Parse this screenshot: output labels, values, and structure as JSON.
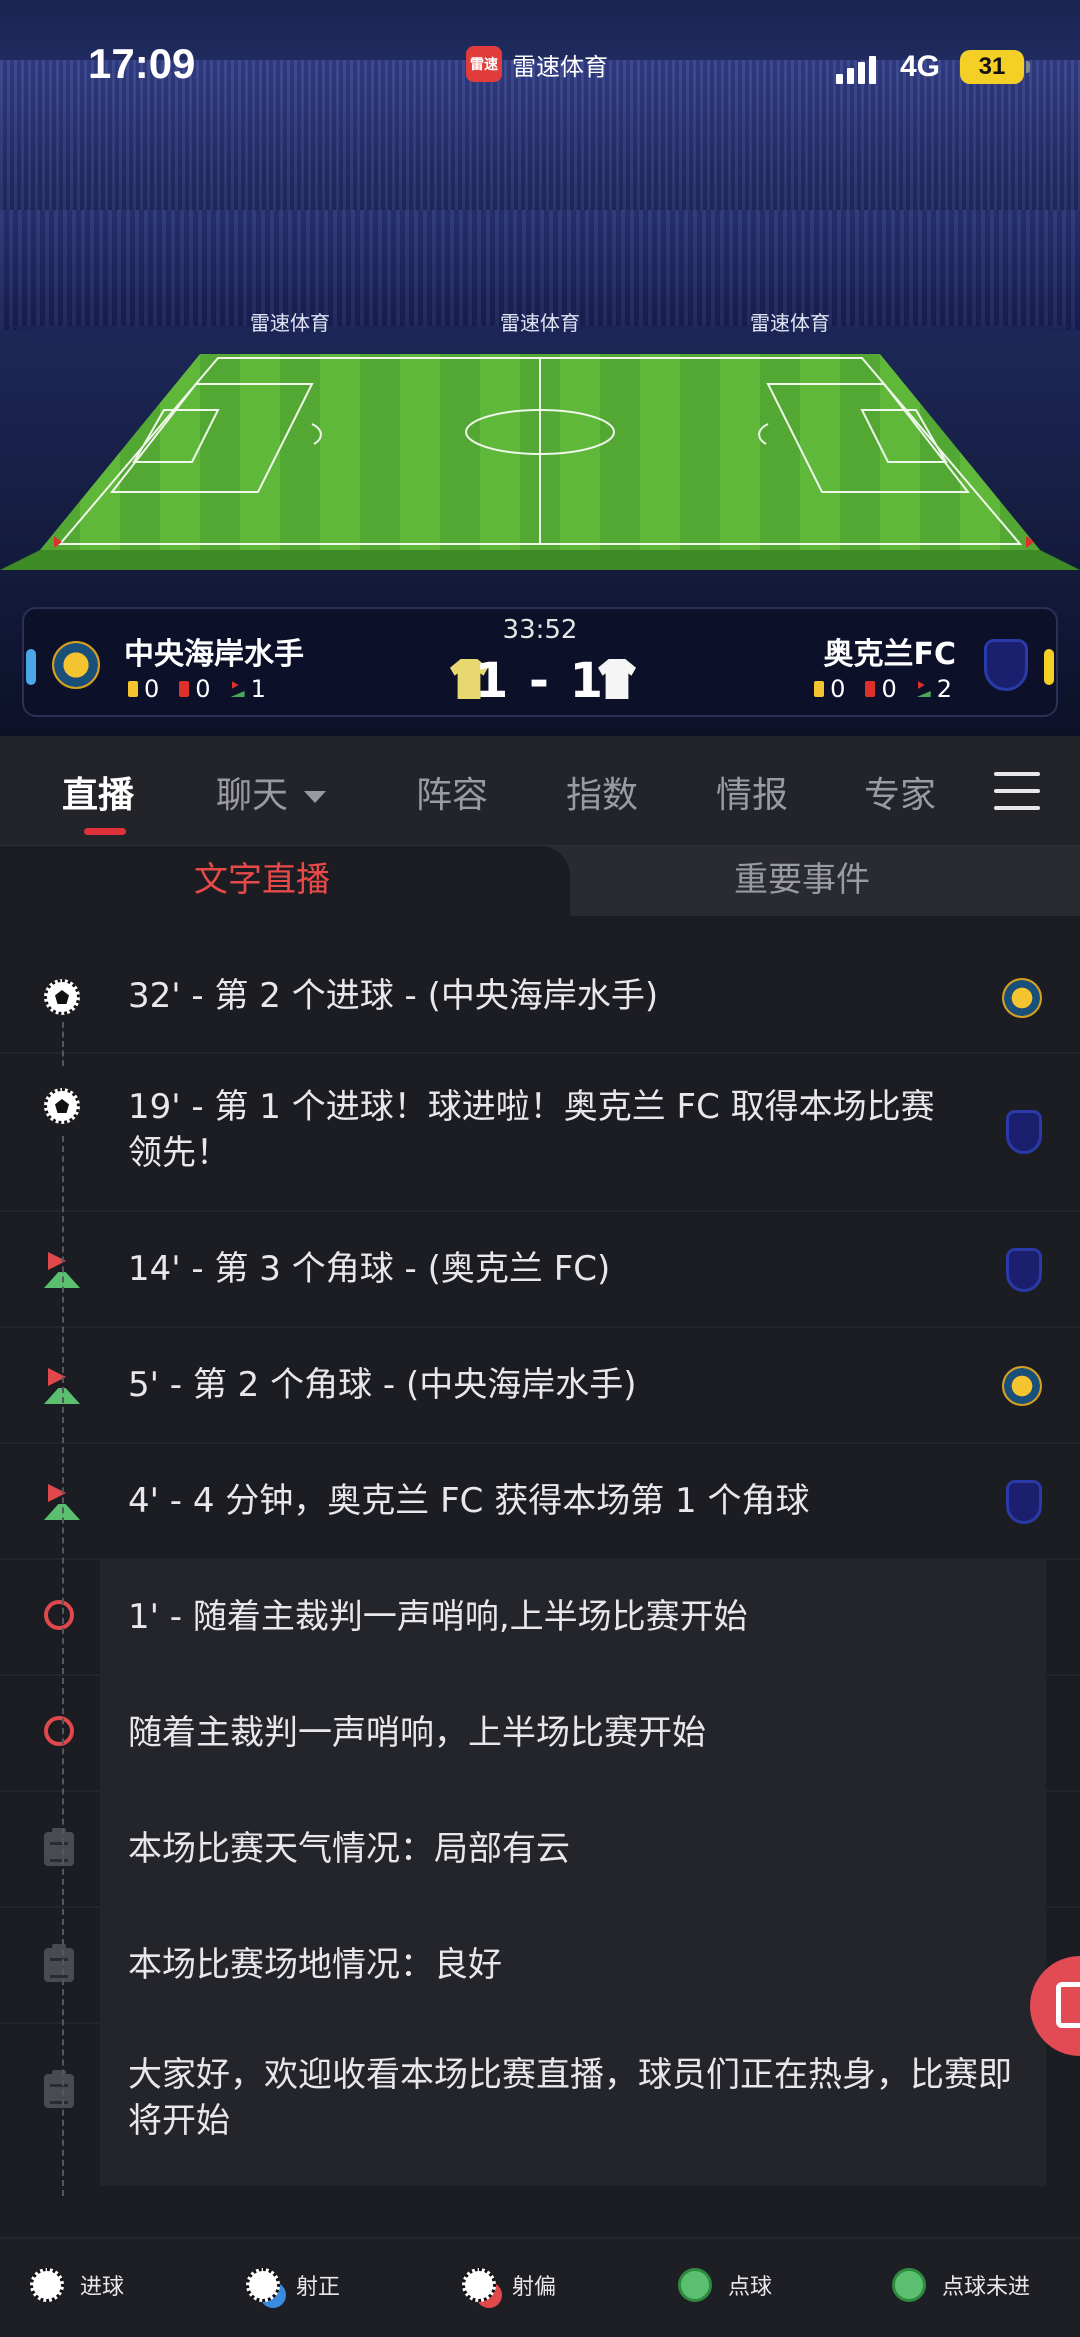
{
  "status_bar": {
    "time": "17:09",
    "app_name": "雷速体育",
    "app_badge": "雷速",
    "network": "4G",
    "battery": "31"
  },
  "match": {
    "clock": "33:52",
    "score": "1 - 1",
    "home": {
      "name": "中央海岸水手",
      "yellow": "0",
      "red": "0",
      "corners": "1"
    },
    "away": {
      "name": "奥克兰FC",
      "yellow": "0",
      "red": "0",
      "corners": "2"
    }
  },
  "pitch_ads": [
    "雷速体育",
    "雷速体育",
    "雷速体育"
  ],
  "tabs": [
    {
      "label": "直播",
      "active": true
    },
    {
      "label": "聊天",
      "active": false
    },
    {
      "label": "阵容",
      "active": false
    },
    {
      "label": "指数",
      "active": false
    },
    {
      "label": "情报",
      "active": false
    },
    {
      "label": "专家",
      "active": false
    }
  ],
  "subtabs": {
    "text_live": "文字直播",
    "key_events": "重要事件"
  },
  "events": [
    {
      "type": "goal",
      "team": "home",
      "text": "32' - 第 2 个进球 - (中央海岸水手)"
    },
    {
      "type": "goal",
      "team": "away",
      "text": "19' - 第 1 个进球！球进啦！奥克兰 FC 取得本场比赛领先！"
    },
    {
      "type": "corner",
      "team": "away",
      "text": "14' - 第 3 个角球 - (奥克兰 FC)"
    },
    {
      "type": "corner",
      "team": "home",
      "text": "5' - 第 2 个角球 - (中央海岸水手)"
    },
    {
      "type": "corner",
      "team": "away",
      "text": "4' - 4 分钟，奥克兰 FC 获得本场第 1 个角球"
    },
    {
      "type": "whistle",
      "team": "",
      "text": "1' - 随着主裁判一声哨响,上半场比赛开始"
    },
    {
      "type": "whistle",
      "team": "",
      "text": "随着主裁判一声哨响，上半场比赛开始"
    },
    {
      "type": "note",
      "team": "",
      "text": "本场比赛天气情况：局部有云"
    },
    {
      "type": "note",
      "team": "",
      "text": "本场比赛场地情况：良好"
    },
    {
      "type": "note",
      "team": "",
      "text": "大家好，欢迎收看本场比赛直播，球员们正在热身，比赛即将开始"
    }
  ],
  "legend": [
    {
      "label": "进球",
      "icon": "goal-icon"
    },
    {
      "label": "射正",
      "icon": "shot-on-target-icon"
    },
    {
      "label": "射偏",
      "icon": "shot-off-target-icon"
    },
    {
      "label": "点球",
      "icon": "penalty-icon"
    },
    {
      "label": "点球未进",
      "icon": "penalty-missed-icon"
    }
  ],
  "colors": {
    "accent": "#e0303c",
    "background": "#1c1d22",
    "row_alt": "#24252b"
  }
}
